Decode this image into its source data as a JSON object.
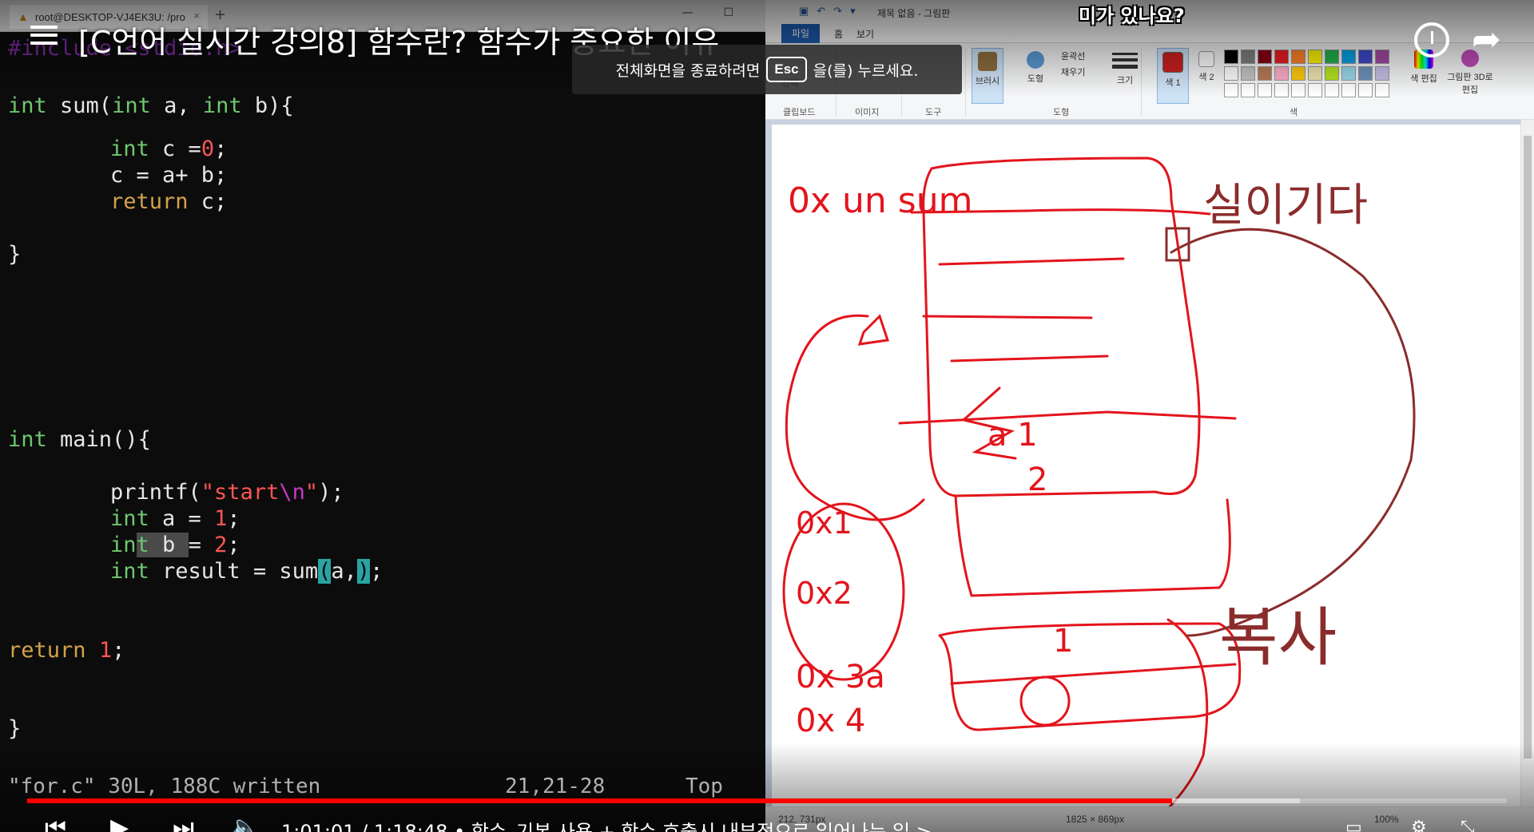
{
  "video": {
    "title": "[C언어 실시간 강의8] 함수란? 함수가 중요한 이유",
    "caption": "미가 있나요?",
    "esc_prefix": "전체화면을 종료하려면",
    "esc_key": "Esc",
    "esc_suffix": "을(를) 누르세요.",
    "time_current": "1:01:01",
    "time_total": "1:18:48",
    "chapter": "• 함수_기본 사용 + 함수 호출시 내부적으로 일어나는 일 >",
    "progress_fraction": 0.774,
    "buffer_fraction": 0.86,
    "accent_color": "#ff0000"
  },
  "terminal": {
    "tab_title": "root@DESKTOP-VJ4EK3U: /pro",
    "tab_close": "×",
    "new_tab": "+",
    "minimize": "—",
    "maximize": "☐",
    "include_line": "#include <stdio.h>",
    "sum_sig": {
      "kw1": "int",
      "t1": " sum(",
      "kw2": "int",
      "t2": " a, ",
      "kw3": "int",
      "t3": " b){"
    },
    "body_line1": {
      "kw": "int",
      "t": " c =",
      "num": "0",
      "end": ";"
    },
    "body_line2": "c = a+ b;",
    "body_line3": {
      "kw": "return",
      "t": " c;"
    },
    "close_brace": "}",
    "main_sig": {
      "kw": "int",
      "t": " main(){"
    },
    "printf_line": {
      "fn": "printf(",
      "str1": "\"start",
      "esc": "\\n",
      "str2": "\"",
      "end": ");"
    },
    "a_line": {
      "kw": "int",
      "t": " a = ",
      "num": "1",
      "end": ";"
    },
    "b_line": {
      "kw1": "in",
      "kw2": "t",
      "sel": " b ",
      "t": "= ",
      "num": "2",
      "end": ";"
    },
    "result_line": {
      "kw": "int",
      "t": " result = sum",
      "p1": "(",
      "t2": "a,",
      "p2": ")",
      "end": ";"
    },
    "return_line": {
      "kw": "return",
      "sp": " ",
      "num": "1",
      "end": ";"
    },
    "status_msg": "\"for.c\" 30L, 188C written",
    "status_pos": "21,21-28",
    "status_top": "Top",
    "colors": {
      "keyword": "#6fc76f",
      "return": "#d4a24c",
      "number": "#ff5555",
      "background": "#0c0c0c"
    }
  },
  "paint": {
    "title": "제목 없음 - 그림판",
    "tab_file": "파일",
    "tab_home": "홈",
    "tab_view": "보기",
    "groups": [
      "클립보드",
      "이미지",
      "도구",
      "도형",
      "색"
    ],
    "select_label": "선택",
    "brush_label": "브러시",
    "shapes_label": "도형",
    "outline_label": "윤곽선",
    "fill_label": "채우기",
    "size_label": "크기",
    "color1_label": "색 1",
    "color2_label": "색 2",
    "edit_colors_label": "색 편집",
    "paint3d_label": "그림판 3D로 편집",
    "status_pos": "212, 731px",
    "status_size": "1825 × 869px",
    "zoom": "100%",
    "active_color": "#cc1f1f",
    "palette": [
      "#000000",
      "#7f7f7f",
      "#880015",
      "#ed1c24",
      "#ff7f27",
      "#fff200",
      "#22b14c",
      "#00a2e8",
      "#3f48cc",
      "#a349a4",
      "#ffffff",
      "#c3c3c3",
      "#b97a57",
      "#ffaec9",
      "#ffc90e",
      "#efe4b0",
      "#b5e61d",
      "#99d9ea",
      "#7092be",
      "#c8bfe7",
      "#ffffff",
      "#ffffff",
      "#ffffff",
      "#ffffff",
      "#ffffff",
      "#ffffff",
      "#ffffff",
      "#ffffff",
      "#ffffff",
      "#ffffff"
    ],
    "drawing": {
      "label_0x_sum": "0x un sum",
      "label_memory": "실이기다",
      "label_a1": "a 1",
      "label_2": "2",
      "label_0x1": "0x1",
      "label_0x2": "0x2",
      "label_0x3": "0x 3a",
      "label_0x4": "0x 4",
      "label_1": "1",
      "label_copy": "복사",
      "ink_red": "#e3141c",
      "ink_brown": "#8b2c2c"
    }
  }
}
